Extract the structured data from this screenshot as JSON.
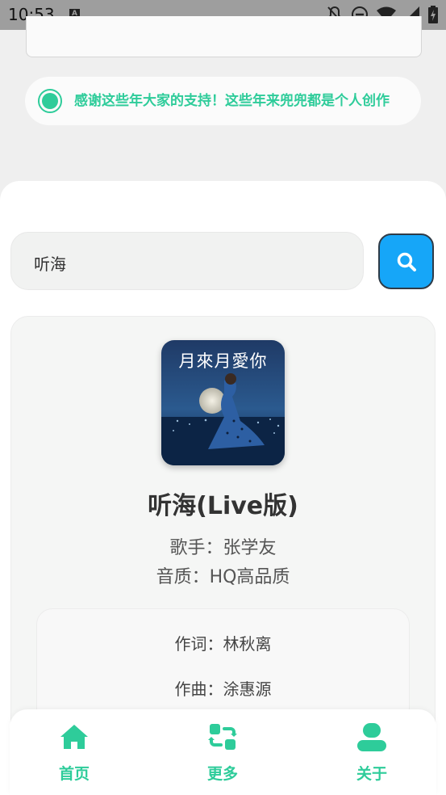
{
  "status_bar": {
    "time": "10:53",
    "sim_label": "A",
    "icons": [
      "notifications-off-icon",
      "do-not-disturb-icon",
      "wifi-icon",
      "signal-icon",
      "battery-icon"
    ]
  },
  "notice": {
    "text": "感谢这些年大家的支持！这些年来兜兜都是个人创作",
    "color": "#2ecc9a"
  },
  "search": {
    "value": "听海",
    "button_color": "#16a6f8"
  },
  "song": {
    "cover_title": "月來月愛你",
    "title": "听海(Live版)",
    "singer_line": "歌手：张学友",
    "quality_line": "音质：HQ高品质",
    "lyricist_line": "作词：林秋离",
    "composer_line": "作曲：涂惠源"
  },
  "nav": {
    "items": [
      {
        "label": "首页",
        "icon": "home-icon"
      },
      {
        "label": "更多",
        "icon": "swap-icon"
      },
      {
        "label": "关于",
        "icon": "user-icon"
      }
    ],
    "accent": "#2ecc9a"
  }
}
